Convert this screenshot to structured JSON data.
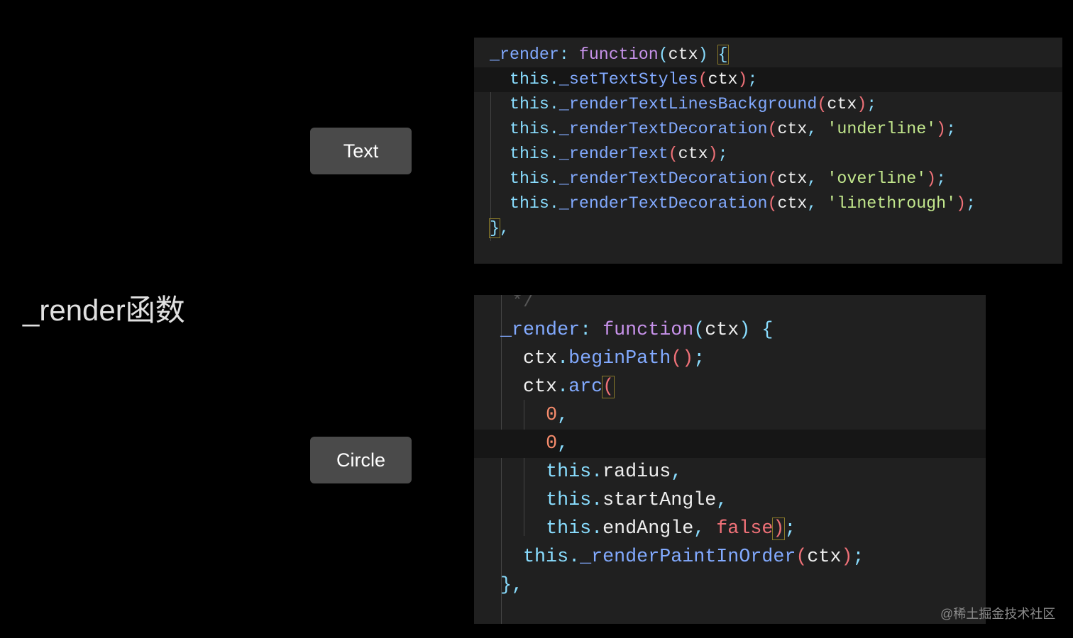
{
  "slide": {
    "title": "_render函数",
    "buttons": {
      "text": "Text",
      "circle": "Circle"
    },
    "watermark": "@稀土掘金技术社区"
  },
  "code_text": {
    "highlight_line": 1,
    "lines": [
      [
        [
          "_render",
          "method"
        ],
        [
          ": ",
          "punc"
        ],
        [
          "function",
          "kw"
        ],
        [
          "(",
          "punc"
        ],
        [
          "ctx",
          "plain"
        ],
        [
          ")",
          "punc"
        ],
        [
          " ",
          ""
        ],
        [
          "{",
          "brace box"
        ]
      ],
      [
        [
          "  ",
          ""
        ],
        [
          "this.",
          "this"
        ],
        [
          "_setTextStyles",
          "method"
        ],
        [
          "(",
          "paren"
        ],
        [
          "ctx",
          "plain"
        ],
        [
          ")",
          "paren"
        ],
        [
          ";",
          "punc"
        ]
      ],
      [
        [
          "  ",
          ""
        ],
        [
          "this.",
          "this"
        ],
        [
          "_renderTextLinesBackground",
          "method"
        ],
        [
          "(",
          "paren"
        ],
        [
          "ctx",
          "plain"
        ],
        [
          ")",
          "paren"
        ],
        [
          ";",
          "punc"
        ]
      ],
      [
        [
          "  ",
          ""
        ],
        [
          "this.",
          "this"
        ],
        [
          "_renderTextDecoration",
          "method"
        ],
        [
          "(",
          "paren"
        ],
        [
          "ctx",
          "plain"
        ],
        [
          ", ",
          "punc"
        ],
        [
          "'underline'",
          "str"
        ],
        [
          ")",
          "paren"
        ],
        [
          ";",
          "punc"
        ]
      ],
      [
        [
          "  ",
          ""
        ],
        [
          "this.",
          "this"
        ],
        [
          "_renderText",
          "method"
        ],
        [
          "(",
          "paren"
        ],
        [
          "ctx",
          "plain"
        ],
        [
          ")",
          "paren"
        ],
        [
          ";",
          "punc"
        ]
      ],
      [
        [
          "  ",
          ""
        ],
        [
          "this.",
          "this"
        ],
        [
          "_renderTextDecoration",
          "method"
        ],
        [
          "(",
          "paren"
        ],
        [
          "ctx",
          "plain"
        ],
        [
          ", ",
          "punc"
        ],
        [
          "'overline'",
          "str"
        ],
        [
          ")",
          "paren"
        ],
        [
          ";",
          "punc"
        ]
      ],
      [
        [
          "  ",
          ""
        ],
        [
          "this.",
          "this"
        ],
        [
          "_renderTextDecoration",
          "method"
        ],
        [
          "(",
          "paren"
        ],
        [
          "ctx",
          "plain"
        ],
        [
          ", ",
          "punc"
        ],
        [
          "'linethrough'",
          "str"
        ],
        [
          ")",
          "paren"
        ],
        [
          ";",
          "punc"
        ]
      ],
      [
        [
          "}",
          "brace box"
        ],
        [
          ",",
          "punc"
        ]
      ]
    ]
  },
  "code_circle": {
    "highlight_line": 5,
    "lines": [
      [
        [
          " */",
          "comment"
        ]
      ],
      [
        [
          "_render",
          "method"
        ],
        [
          ": ",
          "punc"
        ],
        [
          "function",
          "kw"
        ],
        [
          "(",
          "punc"
        ],
        [
          "ctx",
          "plain"
        ],
        [
          ")",
          "punc"
        ],
        [
          " ",
          ""
        ],
        [
          "{",
          "brace"
        ]
      ],
      [
        [
          "  ",
          ""
        ],
        [
          "ctx",
          "plain"
        ],
        [
          ".",
          "punc"
        ],
        [
          "beginPath",
          "method"
        ],
        [
          "()",
          "paren"
        ],
        [
          ";",
          "punc"
        ]
      ],
      [
        [
          "  ",
          ""
        ],
        [
          "ctx",
          "plain"
        ],
        [
          ".",
          "punc"
        ],
        [
          "arc",
          "method"
        ],
        [
          "(",
          "paren box"
        ]
      ],
      [
        [
          "    ",
          ""
        ],
        [
          "0",
          "num"
        ],
        [
          ",",
          "punc"
        ]
      ],
      [
        [
          "    ",
          ""
        ],
        [
          "0",
          "num"
        ],
        [
          ",",
          "punc"
        ]
      ],
      [
        [
          "    ",
          ""
        ],
        [
          "this.",
          "this"
        ],
        [
          "radius",
          "plain"
        ],
        [
          ",",
          "punc"
        ]
      ],
      [
        [
          "    ",
          ""
        ],
        [
          "this.",
          "this"
        ],
        [
          "startAngle",
          "plain"
        ],
        [
          ",",
          "punc"
        ]
      ],
      [
        [
          "    ",
          ""
        ],
        [
          "this.",
          "this"
        ],
        [
          "endAngle",
          "plain"
        ],
        [
          ", ",
          "punc"
        ],
        [
          "false",
          "bool"
        ],
        [
          ")",
          "paren box"
        ],
        [
          ";",
          "punc"
        ]
      ],
      [
        [
          "  ",
          ""
        ],
        [
          "this.",
          "this"
        ],
        [
          "_renderPaintInOrder",
          "method"
        ],
        [
          "(",
          "paren"
        ],
        [
          "ctx",
          "plain"
        ],
        [
          ")",
          "paren"
        ],
        [
          ";",
          "punc"
        ]
      ],
      [
        [
          "}",
          "brace"
        ],
        [
          ",",
          "punc"
        ]
      ]
    ]
  }
}
